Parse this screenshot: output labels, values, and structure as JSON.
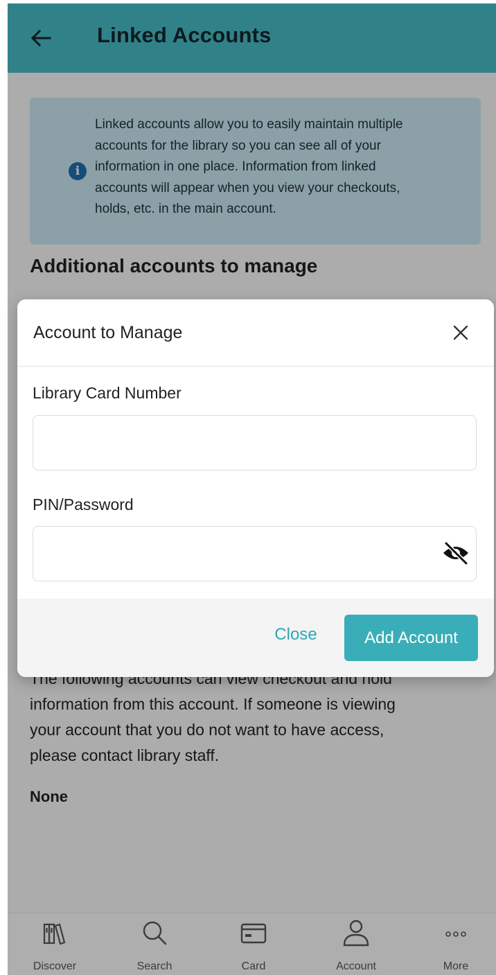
{
  "header": {
    "title": "Linked Accounts"
  },
  "info_box": {
    "lines": [
      "Linked accounts allow you to easily maintain multiple",
      "accounts for the library so you can see all of your",
      "information in one place. Information from linked",
      "accounts will appear when you view your checkouts,",
      "holds, etc. in the main account."
    ],
    "icon": "info-icon"
  },
  "section_heading": "Additional accounts to manage",
  "viewers": {
    "lines": [
      "The following accounts can view checkout and hold",
      "information from this account. If someone is viewing",
      "your account that you do not want to have access,",
      "please contact library staff."
    ],
    "none_label": "None"
  },
  "modal": {
    "title": "Account to Manage",
    "card_label": "Library Card Number",
    "card_value": "",
    "pin_label": "PIN/Password",
    "pin_value": "",
    "close_label": "Close",
    "add_label": "Add Account"
  },
  "bottom_nav": [
    {
      "label": "Discover",
      "icon": "books-icon"
    },
    {
      "label": "Search",
      "icon": "search-icon"
    },
    {
      "label": "Card",
      "icon": "card-icon"
    },
    {
      "label": "Account",
      "icon": "person-icon"
    },
    {
      "label": "More",
      "icon": "more-icon"
    }
  ],
  "colors": {
    "header": "#47b9c3",
    "accent": "#3aaeb8",
    "info_bg": "#c9e6ef",
    "info_icon": "#1f6fae"
  }
}
